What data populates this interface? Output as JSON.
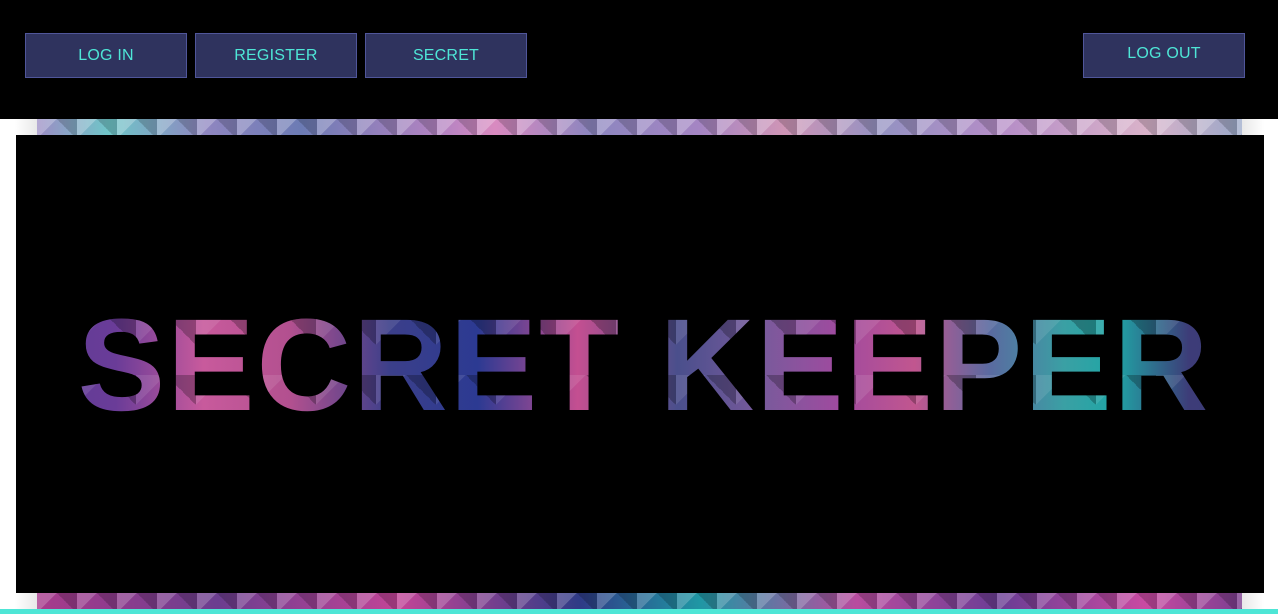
{
  "nav": {
    "login_label": "LOG IN",
    "register_label": "REGISTER",
    "secret_label": "SECRET",
    "logout_label": "LOG OUT"
  },
  "hero": {
    "title": "SECRET KEEPER"
  },
  "colors": {
    "nav_background": "#000000",
    "button_background": "#2f335e",
    "button_text": "#4ee6d6",
    "accent_line": "#4ee6d6",
    "hero_background": "#000000"
  }
}
